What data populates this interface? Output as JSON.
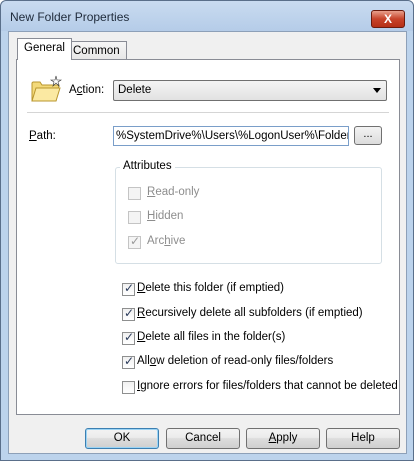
{
  "window": {
    "title": "New Folder Properties",
    "close_glyph": "X"
  },
  "tabs": [
    {
      "label": "General",
      "selected": true
    },
    {
      "label": "Common",
      "selected": false
    }
  ],
  "action": {
    "label_prefix": "A",
    "label_underlined": "c",
    "label_suffix": "tion:",
    "value": "Delete"
  },
  "path": {
    "label_underlined": "P",
    "label_suffix": "ath:",
    "value": "%SystemDrive%\\Users\\%LogonUser%\\Folder",
    "browse_label": "..."
  },
  "attributes": {
    "title": "Attributes",
    "items": [
      {
        "underlined": "R",
        "rest": "ead-only",
        "checked": false
      },
      {
        "underlined": "H",
        "rest": "idden",
        "checked": false
      },
      {
        "underlined": "",
        "prefix": "Arc",
        "underlined2": "h",
        "rest": "ive",
        "checked": true
      }
    ]
  },
  "options": [
    {
      "underlined": "D",
      "rest": "elete this folder (if emptied)",
      "checked": true
    },
    {
      "underlined": "R",
      "rest": "ecursively delete all subfolders (if emptied)",
      "checked": true
    },
    {
      "underlined": "D",
      "rest": "elete all files in the folder(s)",
      "checked": true
    },
    {
      "prefix": "All",
      "underlined": "o",
      "rest": "w deletion of read-only files/folders",
      "checked": true
    },
    {
      "underlined": "I",
      "rest": "gnore errors for files/folders that cannot be deleted",
      "checked": false
    }
  ],
  "buttons": {
    "ok": "OK",
    "cancel": "Cancel",
    "apply_underlined": "A",
    "apply_rest": "pply",
    "help": "Help"
  },
  "icons": {
    "folder": "new-folder-icon",
    "dropdown": "chevron-down-icon",
    "check": "✓"
  }
}
